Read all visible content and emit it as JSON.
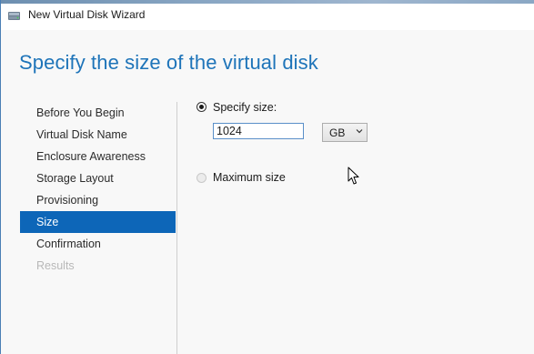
{
  "window": {
    "title": "New Virtual Disk Wizard",
    "icon": "virtual-disk-wizard-icon"
  },
  "page": {
    "heading": "Specify the size of the virtual disk"
  },
  "nav": {
    "items": [
      {
        "label": "Before You Begin",
        "state": "normal"
      },
      {
        "label": "Virtual Disk Name",
        "state": "normal"
      },
      {
        "label": "Enclosure Awareness",
        "state": "normal"
      },
      {
        "label": "Storage Layout",
        "state": "normal"
      },
      {
        "label": "Provisioning",
        "state": "normal"
      },
      {
        "label": "Size",
        "state": "active"
      },
      {
        "label": "Confirmation",
        "state": "normal"
      },
      {
        "label": "Results",
        "state": "disabled"
      }
    ]
  },
  "size_options": {
    "specify_label": "Specify size:",
    "specify_selected": true,
    "size_value": "1024",
    "unit": "GB",
    "maximum_label": "Maximum size",
    "maximum_enabled": false
  },
  "colors": {
    "accent": "#1e74b9",
    "active_nav_bg": "#0d66b8",
    "disabled_text": "#b8b8b8"
  }
}
